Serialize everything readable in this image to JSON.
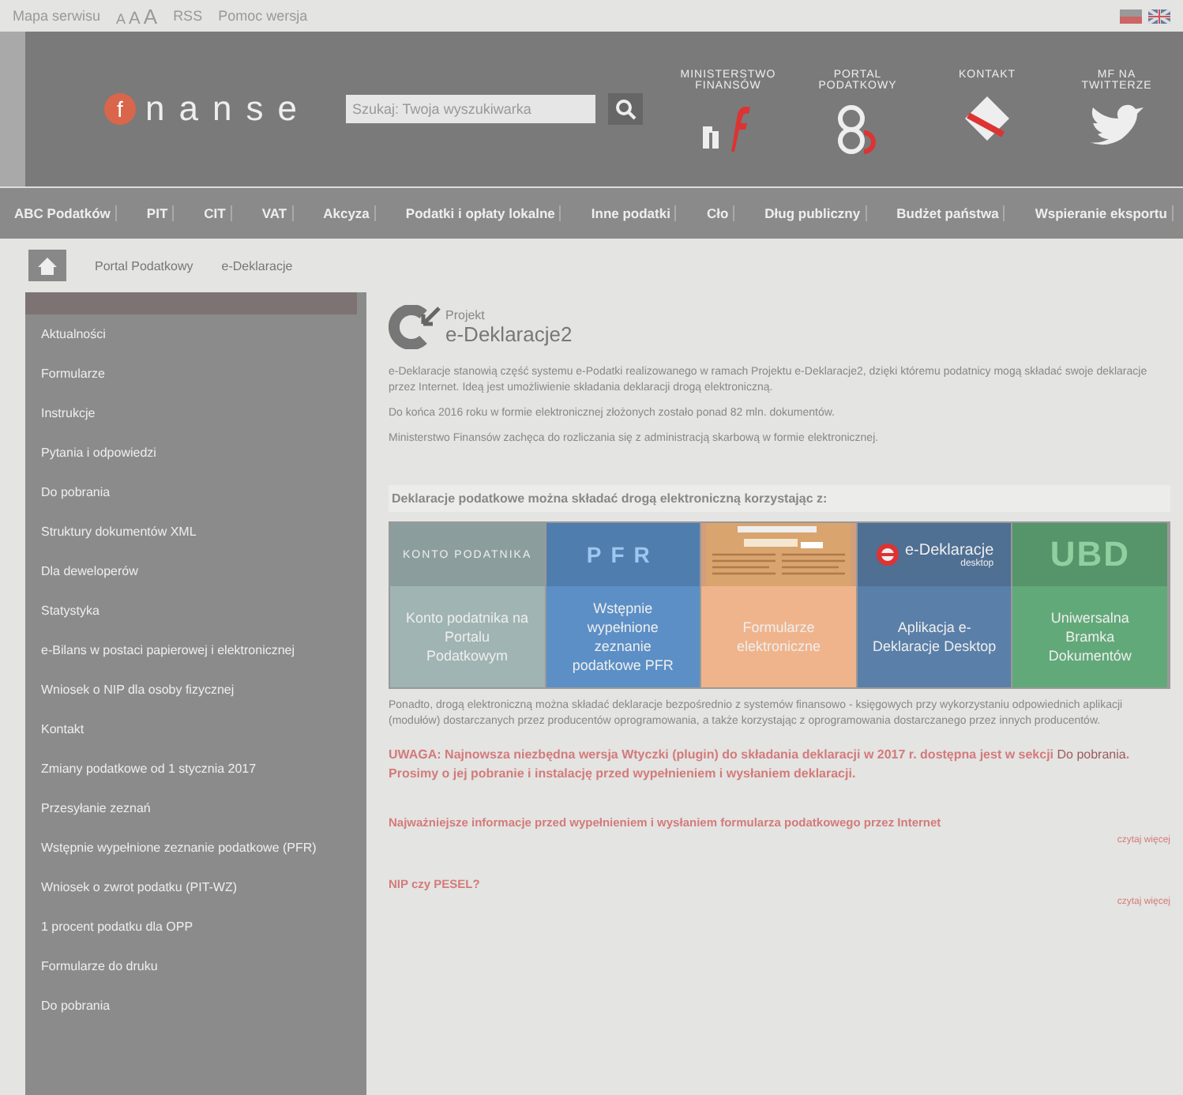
{
  "top_bar": {
    "links": [
      "Mapa serwisu",
      "RSS",
      "Pomoc wersja"
    ],
    "font_sizes": [
      "A",
      "A",
      "A"
    ]
  },
  "header": {
    "logo": {
      "mark": "f",
      "text": "nanse"
    },
    "search": {
      "placeholder": "Szukaj: Twoja wyszukiwarka"
    },
    "shortcuts": [
      {
        "label": "MINISTERSTWO FINANSÓW",
        "kind": "mf"
      },
      {
        "label": "PORTAL PODATKOWY",
        "kind": "portal"
      },
      {
        "label": "KONTAKT",
        "kind": "contact"
      },
      {
        "label": "MF NA TWITTERZE",
        "kind": "twitter"
      }
    ]
  },
  "nav": [
    "ABC Podatków",
    "PIT",
    "CIT",
    "VAT",
    "Akcyza",
    "Podatki i opłaty lokalne",
    "Inne podatki",
    "Cło",
    "Dług publiczny",
    "Budżet państwa",
    "Wspieranie eksportu"
  ],
  "breadcrumb": [
    "Portal Podatkowy",
    "e-Deklaracje"
  ],
  "sidebar": {
    "items": [
      "Aktualności",
      "Formularze",
      "Instrukcje",
      "Pytania i odpowiedzi",
      "Do pobrania",
      "Struktury dokumentów XML",
      "Dla deweloperów",
      "Statystyka",
      "e-Bilans w postaci papierowej i elektronicznej",
      "Wniosek o NIP dla osoby fizycznej",
      "Kontakt",
      "Zmiany podatkowe od 1 stycznia 2017",
      "Przesyłanie zeznań",
      "Wstępnie wypełnione zeznanie podatkowe (PFR)",
      "Wniosek o zwrot podatku (PIT-WZ)",
      "1 procent podatku dla OPP",
      "Formularze do druku",
      "Do pobrania"
    ]
  },
  "content": {
    "logo": {
      "line1": "Projekt",
      "line2": "e-Deklaracje2"
    },
    "paragraphs": [
      "e-Deklaracje stanowią część systemu e-Podatki realizowanego w ramach Projektu e-Deklaracje2, dzięki któremu podatnicy mogą składać swoje deklaracje przez Internet. Ideą jest umożliwienie składania deklaracji drogą elektroniczną.",
      "Do końca 2016 roku w formie elektronicznej złożonych zostało ponad 82 mln. dokumentów.",
      "Ministerstwo Finansów zachęca do rozliczania się z administracją skarbową w formie elektronicznej."
    ],
    "options_heading": "Deklaracje podatkowe można składać drogą elektroniczną korzystając z:",
    "tiles": [
      {
        "kind": "konto",
        "banner": "KONTO PODATNIKA",
        "label": "Konto podatnika na Portalu Podatkowym",
        "color": "#9fb4b3"
      },
      {
        "kind": "pfr",
        "banner": "PFR",
        "label": "Wstępnie wypełnione zeznanie podatkowe PFR",
        "color": "#5b8fc6"
      },
      {
        "kind": "form",
        "label": "Formularze elektroniczne",
        "color": "#f0b48c"
      },
      {
        "kind": "edek",
        "banner": "e-Deklaracje",
        "banner_sub": "desktop",
        "label": "Aplikacja e-Deklaracje Desktop",
        "color": "#5a7fa8"
      },
      {
        "kind": "ubd",
        "banner": "UBD",
        "label": "Uniwersalna Bramka Dokumentów",
        "color": "#62a979"
      }
    ],
    "paragraph_after": "Ponadto, drogą elektroniczną można składać deklaracje bezpośrednio z systemów finansowo - księgowych przy wykorzystaniu odpowiednich aplikacji (modułów) dostarczanych przez producentów oprogramowania, a także korzystając z oprogramowania dostarczanego przez innych producentów.",
    "notice": {
      "before": "UWAGA: Najnowsza niezbędna wersja Wtyczki (plugin) do składania deklaracji w 2017 r. dostępna jest w sekcji",
      "link": "Do pobrania",
      "after": ". Prosimy o jej pobranie i instalację przed wypełnieniem i wysłaniem deklaracji."
    },
    "articles": [
      {
        "title": "Najważniejsze informacje przed wypełnieniem i wysłaniem formularza podatkowego przez Internet",
        "more": "czytaj więcej"
      },
      {
        "title": "NIP czy PESEL?",
        "more": "czytaj więcej"
      }
    ]
  }
}
